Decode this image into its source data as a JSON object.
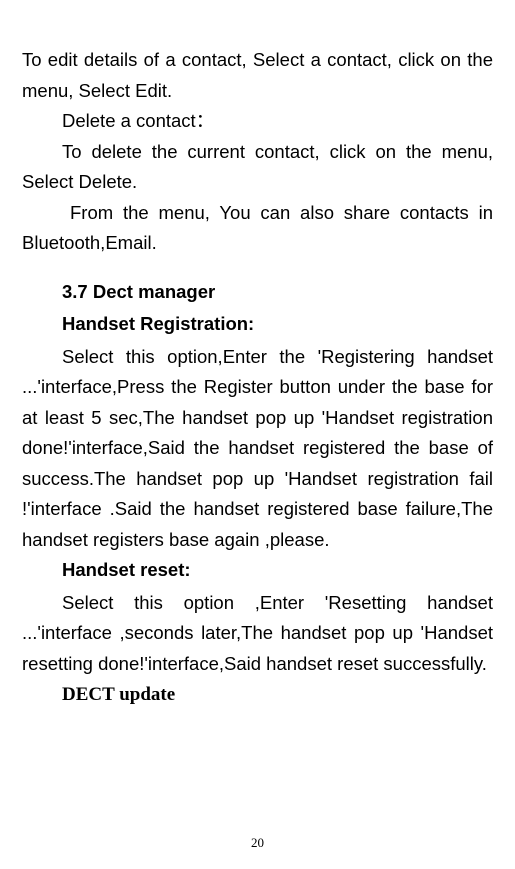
{
  "p1": "To edit details of a contact, Select a contact, click on the menu, Select Edit.",
  "p2": "Delete a contact：",
  "p3": "To delete the current contact, click on the menu, Select Delete.",
  "p4": "From the menu, You can also share contacts in Bluetooth,Email.",
  "section_3_7": "3.7    Dect manager",
  "handset_registration_heading": "Handset Registration:",
  "handset_registration_body": "Select this option,Enter the 'Registering handset ...'interface,Press the Register button under the base for at least 5 sec,The handset pop up 'Handset registration done!'interface,Said the handset registered  the base of success.The handset pop up 'Handset registration fail !'interface .Said the  handset registered base failure,The handset registers base again ,please.",
  "handset_reset_heading": "Handset reset:",
  "handset_reset_body": "Select this option ,Enter 'Resetting handset ...'interface ,seconds later,The handset pop up 'Handset resetting done!'interface,Said handset reset   successfully.",
  "dect_update_heading": "DECT update",
  "page_number": "20"
}
